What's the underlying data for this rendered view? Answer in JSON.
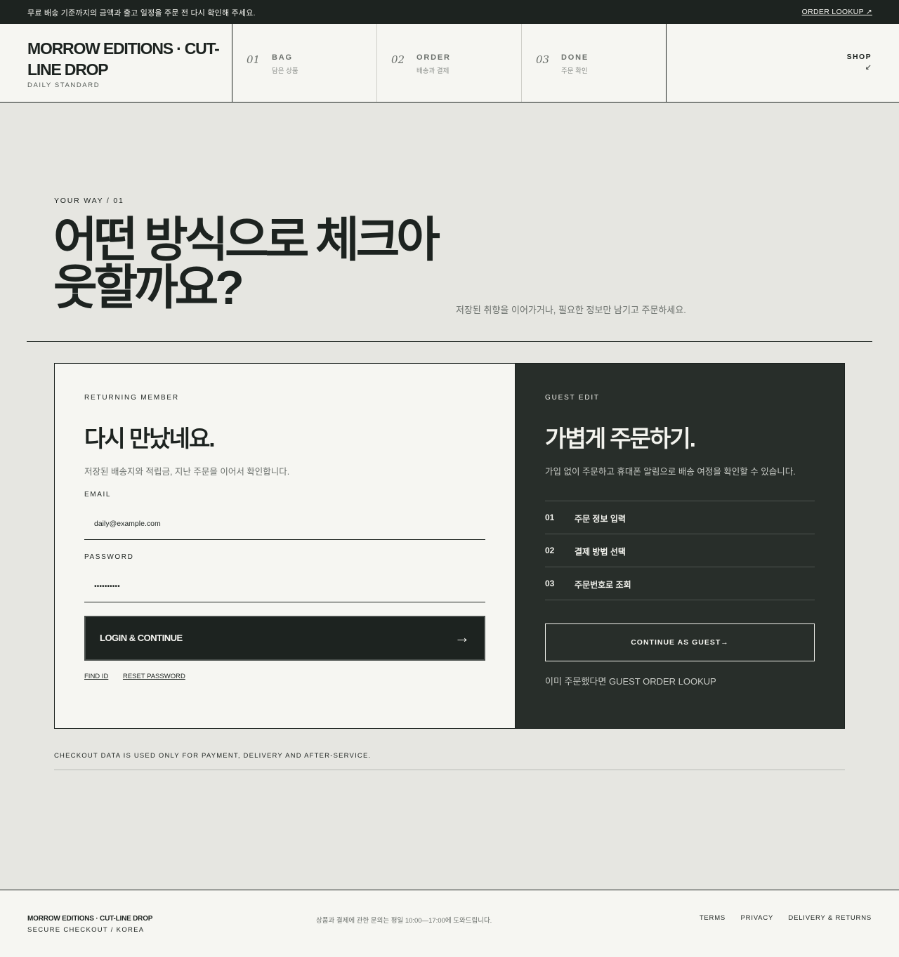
{
  "topbar": {
    "message": "무료 배송 기준까지의 금액과 출고 일정을 주문 전 다시 확인해 주세요.",
    "lookup_link": "ORDER LOOKUP ↗"
  },
  "header": {
    "brand_name": "MORROW EDITIONS · CUT-LINE DROP",
    "brand_tag": "DAILY STANDARD",
    "steps": [
      {
        "num": "01",
        "title": "BAG",
        "sub": "담은 상품"
      },
      {
        "num": "02",
        "title": "ORDER",
        "sub": "배송과 결제"
      },
      {
        "num": "03",
        "title": "DONE",
        "sub": "주문 확인"
      }
    ],
    "shop_label": "SHOP",
    "shop_arrow": "↙"
  },
  "hero": {
    "eyebrow": "YOUR WAY / 01",
    "headline": "어떤 방식으로 체크아웃할까요?",
    "lead": "저장된 취향을 이어가거나, 필요한 정보만 남기고 주문하세요."
  },
  "member": {
    "eyebrow": "RETURNING MEMBER",
    "title": "다시 만났네요.",
    "desc": "저장된 배송지와 적립금, 지난 주문을 이어서 확인합니다.",
    "email_label": "EMAIL",
    "email_value": "daily@example.com",
    "password_label": "PASSWORD",
    "password_value": "••••••••••",
    "login_label": "LOGIN & CONTINUE",
    "login_arrow": "→",
    "find_id": "FIND ID",
    "reset_password": "RESET PASSWORD"
  },
  "guest": {
    "eyebrow": "GUEST EDIT",
    "title": "가볍게 주문하기.",
    "desc": "가입 없이 주문하고 휴대폰 알림으로 배송 여정을 확인할 수 있습니다.",
    "steps": [
      {
        "num": "01",
        "text": "주문 정보 입력"
      },
      {
        "num": "02",
        "text": "결제 방법 선택"
      },
      {
        "num": "03",
        "text": "주문번호로 조회"
      }
    ],
    "button_label": "CONTINUE AS GUEST→",
    "note": "이미 주문했다면 GUEST ORDER LOOKUP"
  },
  "notice": "CHECKOUT DATA IS USED ONLY FOR PAYMENT, DELIVERY AND AFTER-SERVICE.",
  "footer": {
    "brand": "MORROW EDITIONS · CUT-LINE DROP",
    "sub": "SECURE CHECKOUT / KOREA",
    "note": "상품과 결제에 관한 문의는 평일 10:00—17:00에 도와드립니다.",
    "links": [
      "TERMS",
      "PRIVACY",
      "DELIVERY & RETURNS"
    ]
  }
}
